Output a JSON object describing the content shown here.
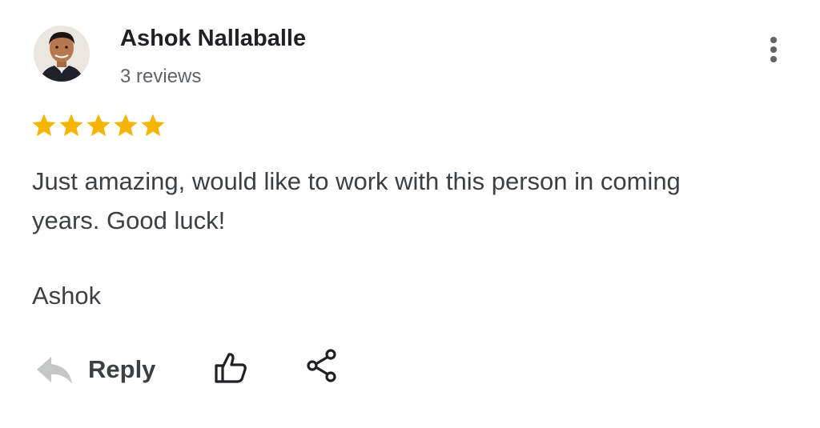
{
  "review": {
    "author": "Ashok Nallaballe",
    "review_count": "3 reviews",
    "rating": 5,
    "rating_max": 5,
    "text": "Just amazing, would like to work with this person in coming years. Good luck!",
    "signoff": "Ashok"
  },
  "actions": {
    "reply_label": "Reply",
    "reply_icon": "reply-arrow-icon",
    "like_icon": "thumbs-up-icon",
    "share_icon": "share-icon",
    "more_icon": "more-vertical-icon"
  },
  "colors": {
    "star": "#f4b400",
    "name": "#202124",
    "secondary": "#5f6368",
    "body": "#3c4043",
    "reply_icon": "#c4c7c5"
  }
}
